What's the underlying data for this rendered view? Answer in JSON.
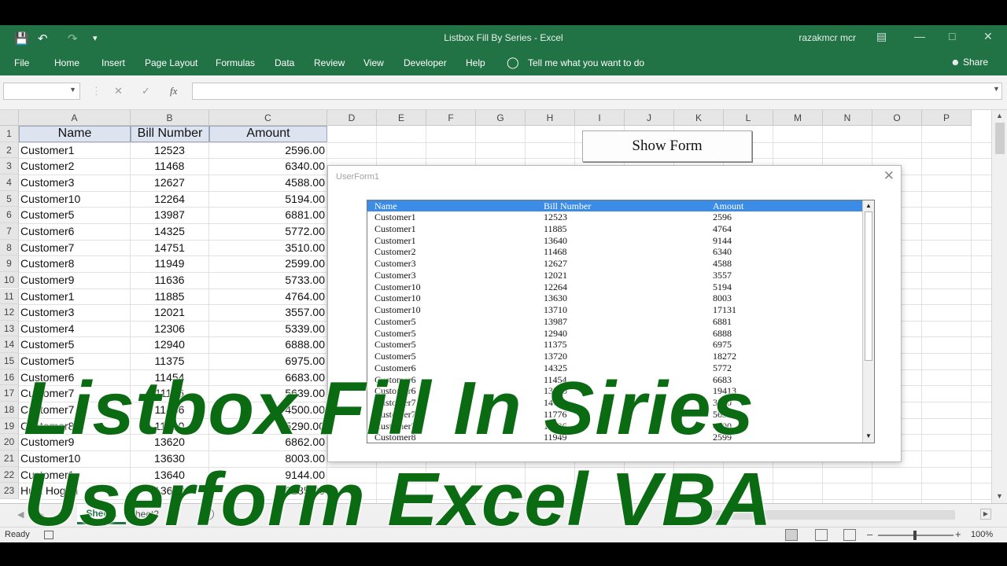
{
  "app": {
    "title": "Listbox Fill By Series  -  Excel",
    "user": "razakmcr mcr",
    "share": "Share"
  },
  "icons": {
    "save": "save-icon",
    "undo": "undo-icon",
    "redo": "redo-icon",
    "customize": "customize-toolbar-icon",
    "lightbulb": "lightbulb-icon",
    "person": "person-icon",
    "cancel": "cancel-icon",
    "enter": "enter-icon",
    "function": "function-icon"
  },
  "ribbon": {
    "tabs": [
      "File",
      "Home",
      "Insert",
      "Page Layout",
      "Formulas",
      "Data",
      "Review",
      "View",
      "Developer",
      "Help"
    ],
    "tell_me": "Tell me what you want to do"
  },
  "formula_bar": {
    "fx": "fx",
    "name_box": "",
    "formula": ""
  },
  "sheet": {
    "columns": [
      "A",
      "B",
      "C",
      "D",
      "E",
      "F",
      "G",
      "H",
      "I",
      "J",
      "K",
      "L",
      "M",
      "N",
      "O",
      "P"
    ],
    "rows": [
      "1",
      "2",
      "3",
      "4",
      "5",
      "6",
      "7",
      "8",
      "9",
      "10",
      "11",
      "12",
      "13",
      "14",
      "15",
      "16",
      "17",
      "18",
      "19",
      "20",
      "21",
      "22",
      "23"
    ],
    "headers": [
      "Name",
      "Bill Number",
      "Amount"
    ],
    "data": [
      [
        "Customer1",
        "12523",
        "2596.00"
      ],
      [
        "Customer2",
        "11468",
        "6340.00"
      ],
      [
        "Customer3",
        "12627",
        "4588.00"
      ],
      [
        "Customer10",
        "12264",
        "5194.00"
      ],
      [
        "Customer5",
        "13987",
        "6881.00"
      ],
      [
        "Customer6",
        "14325",
        "5772.00"
      ],
      [
        "Customer7",
        "14751",
        "3510.00"
      ],
      [
        "Customer8",
        "11949",
        "2599.00"
      ],
      [
        "Customer9",
        "11636",
        "5733.00"
      ],
      [
        "Customer1",
        "11885",
        "4764.00"
      ],
      [
        "Customer3",
        "12021",
        "3557.00"
      ],
      [
        "Customer4",
        "12306",
        "5339.00"
      ],
      [
        "Customer5",
        "12940",
        "6888.00"
      ],
      [
        "Customer5",
        "11375",
        "6975.00"
      ],
      [
        "Customer6",
        "11454",
        "6683.00"
      ],
      [
        "Customer7",
        "11176",
        "5639.00"
      ],
      [
        "Customer7",
        "11436",
        "4500.00"
      ],
      [
        "Customer8",
        "11610",
        "5290.00"
      ],
      [
        "Customer9",
        "13620",
        "6862.00"
      ],
      [
        "Customer10",
        "13630",
        "8003.00"
      ],
      [
        "Customer1",
        "13640",
        "9144.00"
      ],
      [
        "Hulk Hogan",
        "13650",
        "10285.00"
      ]
    ],
    "show_form_button": "Show Form",
    "tabs": [
      "Sheet1",
      "Sheet2"
    ],
    "add_sheet": "+"
  },
  "userform": {
    "title": "UserForm1",
    "close": "✕",
    "listbox": {
      "headers": [
        "Name",
        "Bill Number",
        "Amount"
      ],
      "rows": [
        [
          "Customer1",
          "12523",
          "2596"
        ],
        [
          "Customer1",
          "11885",
          "4764"
        ],
        [
          "Customer1",
          "13640",
          "9144"
        ],
        [
          "Customer2",
          "11468",
          "6340"
        ],
        [
          "Customer3",
          "12627",
          "4588"
        ],
        [
          "Customer3",
          "12021",
          "3557"
        ],
        [
          "Customer10",
          "12264",
          "5194"
        ],
        [
          "Customer10",
          "13630",
          "8003"
        ],
        [
          "Customer10",
          "13710",
          "17131"
        ],
        [
          "Customer5",
          "13987",
          "6881"
        ],
        [
          "Customer5",
          "12940",
          "6888"
        ],
        [
          "Customer5",
          "11375",
          "6975"
        ],
        [
          "Customer5",
          "13720",
          "18272"
        ],
        [
          "Customer6",
          "14325",
          "5772"
        ],
        [
          "Customer6",
          "11454",
          "6683"
        ],
        [
          "Customer6",
          "13730",
          "19413"
        ],
        [
          "Customer7",
          "14751",
          "3510"
        ],
        [
          "Customer7",
          "11776",
          "5639"
        ],
        [
          "Customer7",
          "11436",
          "4500"
        ],
        [
          "Customer8",
          "11949",
          "2599"
        ]
      ]
    }
  },
  "status": {
    "ready": "Ready",
    "zoom": "100%"
  },
  "overlay": {
    "line1": "Listbox Fill In Siries",
    "line2": "Userform Excel VBA"
  },
  "colors": {
    "excel_green": "#217346",
    "header_fill": "#dde4f0",
    "listbox_header": "#3b8ce6",
    "overlay_text": "#0b6b12"
  }
}
